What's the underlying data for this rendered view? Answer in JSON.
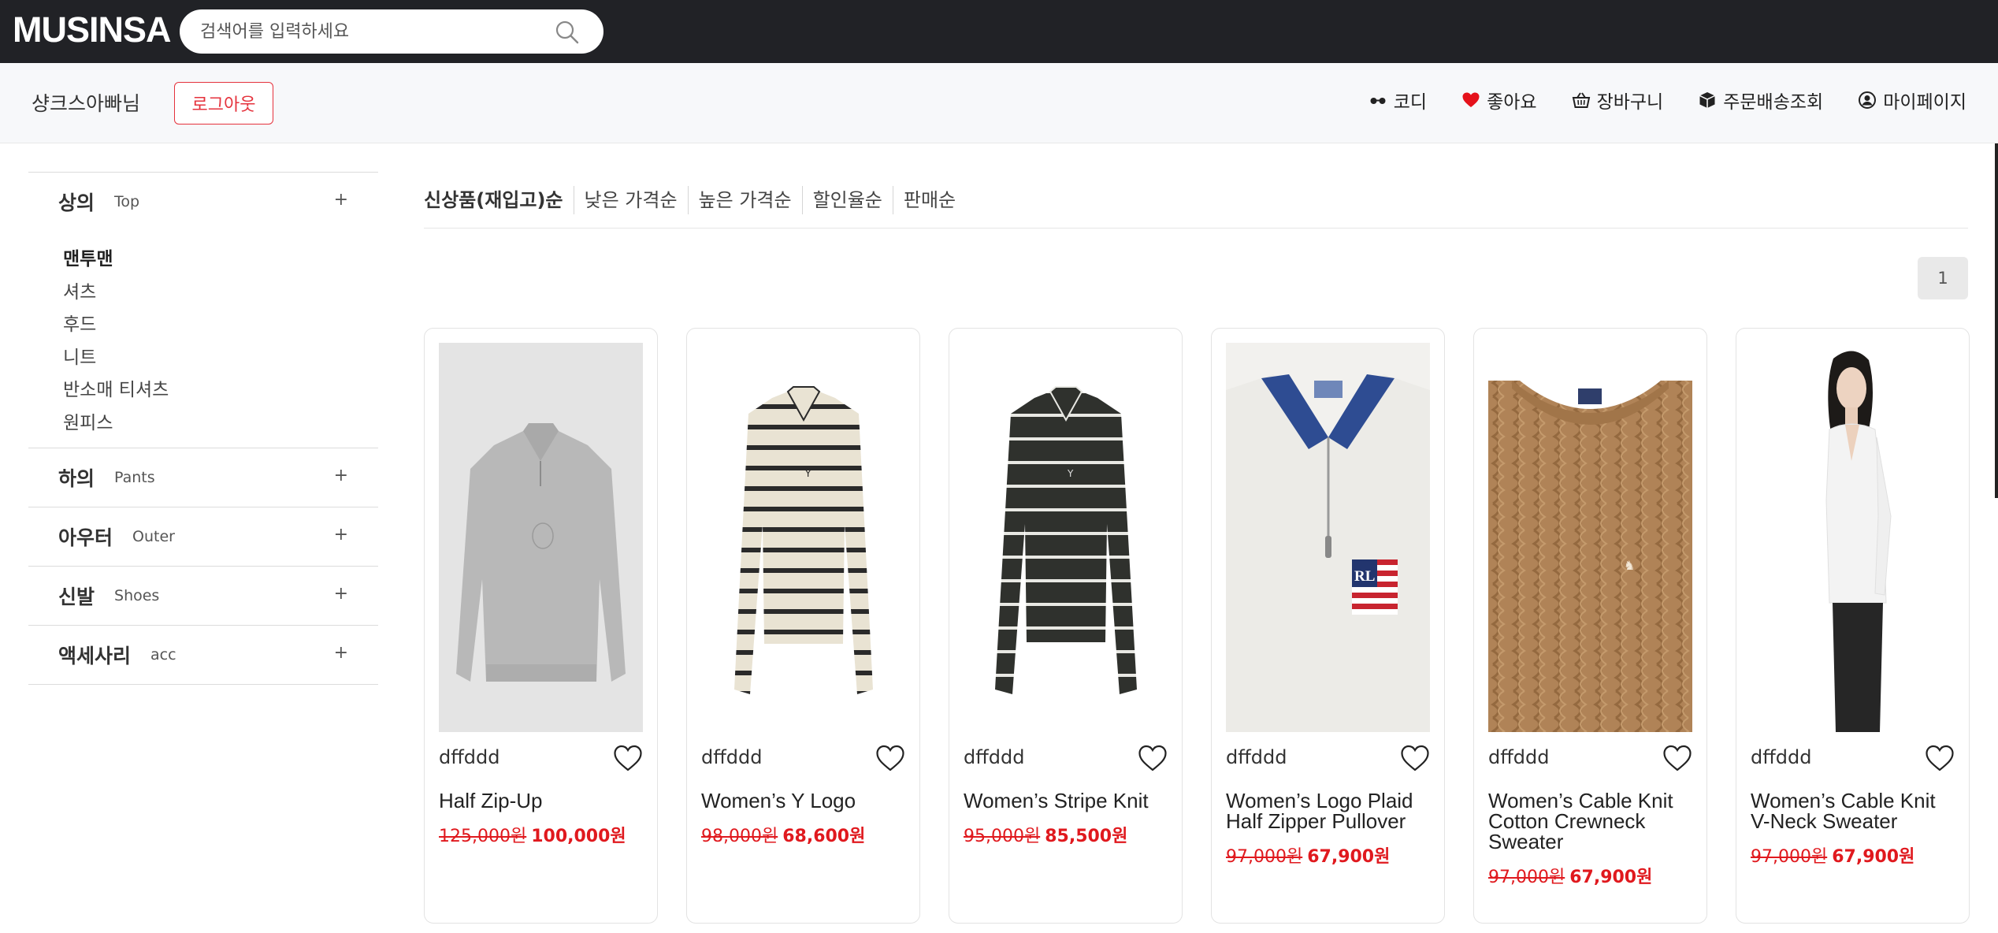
{
  "header": {
    "logo": "MUSINSA",
    "search_placeholder": "검색어를 입력하세요"
  },
  "subheader": {
    "username": "샹크스아빠님",
    "logout_label": "로그아웃",
    "nav": [
      {
        "label": "코디",
        "icon": "glasses-icon"
      },
      {
        "label": "좋아요",
        "icon": "heart-icon",
        "color": "#e5121b"
      },
      {
        "label": "장바구니",
        "icon": "basket-icon"
      },
      {
        "label": "주문배송조회",
        "icon": "box-icon"
      },
      {
        "label": "마이페이지",
        "icon": "user-circle-icon"
      }
    ]
  },
  "sidebar": {
    "categories": [
      {
        "ko": "상의",
        "en": "Top",
        "expanded": true,
        "items": [
          "맨투맨",
          "셔츠",
          "후드",
          "니트",
          "반소매 티셔츠",
          "원피스"
        ]
      },
      {
        "ko": "하의",
        "en": "Pants"
      },
      {
        "ko": "아우터",
        "en": "Outer"
      },
      {
        "ko": "신발",
        "en": "Shoes"
      },
      {
        "ko": "액세사리",
        "en": "acc"
      }
    ],
    "toggle_symbol": "+"
  },
  "sort_options": [
    "신상품(재입고)순",
    "낮은 가격순",
    "높은 가격순",
    "할인율순",
    "판매순"
  ],
  "pagination": {
    "current": "1"
  },
  "products": [
    {
      "brand": "dffddd",
      "name_lines": [
        "Half Zip-Up"
      ],
      "original_price": "125,000원",
      "sale_price": "100,000원",
      "image": "grey-half-zip-sweater"
    },
    {
      "brand": "dffddd",
      "name_lines": [
        "Women’s Y Logo"
      ],
      "original_price": "98,000원",
      "sale_price": "68,600원",
      "image": "cream-striped-polo-knit"
    },
    {
      "brand": "dffddd",
      "name_lines": [
        "Women’s Stripe Knit"
      ],
      "original_price": "95,000원",
      "sale_price": "85,500원",
      "image": "dark-striped-polo-knit"
    },
    {
      "brand": "dffddd",
      "name_lines": [
        "Women’s Logo Plaid",
        "Half Zipper Pullover"
      ],
      "original_price": "97,000원",
      "sale_price": "67,900원",
      "image": "white-flag-zip-pullover"
    },
    {
      "brand": "dffddd",
      "name_lines": [
        "Women’s Cable Knit",
        "Cotton Crewneck",
        "Sweater"
      ],
      "original_price": "97,000원",
      "sale_price": "67,900원",
      "image": "tan-cable-knit-sweater"
    },
    {
      "brand": "dffddd",
      "name_lines": [
        "Women’s Cable Knit",
        "V-Neck Sweater"
      ],
      "original_price": "97,000원",
      "sale_price": "67,900원",
      "image": "model-white-vneck-sweater"
    }
  ],
  "colors": {
    "topbar": "#212226",
    "accent_red": "#e0191e",
    "subheader_bg": "#f7f8fa"
  }
}
